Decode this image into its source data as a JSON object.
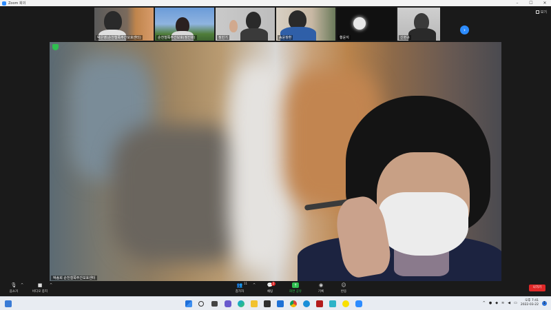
{
  "window": {
    "title": "Zoom 회의",
    "controls": {
      "minimize": "–",
      "maximize": "☐",
      "close": "✕"
    }
  },
  "gallery": {
    "view_label": "보기",
    "participants": [
      {
        "name": "박은영(순천철쭉주간보호센터)"
      },
      {
        "name": "순천철쭉주간보호(정진화)"
      },
      {
        "name": "정민기"
      },
      {
        "name": "송윤창환"
      },
      {
        "name": "황윤지"
      },
      {
        "name": "신현규"
      }
    ],
    "next_icon": "chevron-right-icon"
  },
  "main_video": {
    "speaker_name": "박송희 순천철쭉주간보호센터",
    "security_icon": "shield-icon"
  },
  "toolbar": {
    "left": [
      {
        "label": "음소거",
        "icon": "microphone-icon"
      },
      {
        "label": "비디오 중지",
        "icon": "video-camera-icon"
      }
    ],
    "center": [
      {
        "label": "참가자",
        "icon": "participants-icon",
        "count": "11"
      },
      {
        "label": "채팅",
        "icon": "chat-icon",
        "badge": "2"
      },
      {
        "label": "화면 공유",
        "icon": "share-screen-icon"
      },
      {
        "label": "기록",
        "icon": "record-icon"
      },
      {
        "label": "반응",
        "icon": "reactions-icon"
      }
    ],
    "leave_label": "나가기",
    "accent": "#2d8cff",
    "share_color": "#2fbf4f",
    "leave_color": "#e02828"
  },
  "taskbar": {
    "icons": [
      "widgets-icon",
      "windows-start-icon",
      "search-icon",
      "task-view-icon",
      "chat-icon",
      "edge-icon",
      "file-explorer-icon",
      "store-icon",
      "mail-icon",
      "chrome-icon",
      "app-icon",
      "acrobat-icon",
      "app-icon-2",
      "kakaotalk-icon",
      "zoom-icon"
    ],
    "clock": {
      "time": "오후 7:41",
      "date": "2022-03-22"
    },
    "notification_count": "1"
  }
}
